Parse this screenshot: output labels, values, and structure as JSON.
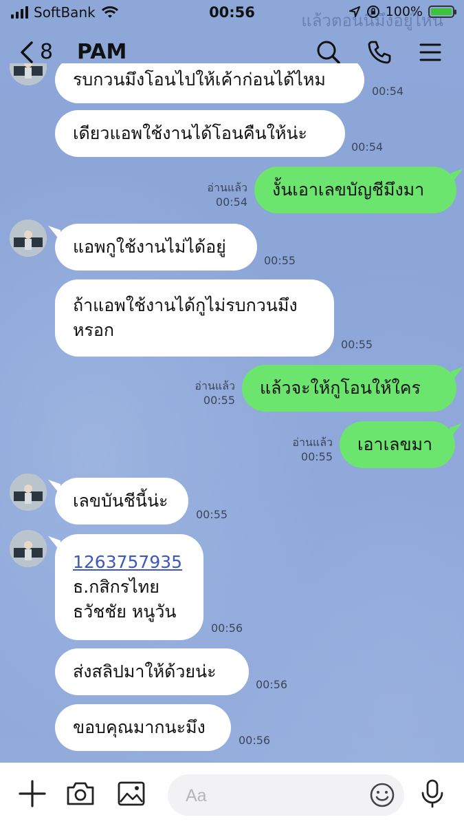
{
  "status_bar": {
    "carrier": "SoftBank",
    "time": "00:56",
    "battery": "100%",
    "battery_level": 1.0
  },
  "background_message": "แล้วตอนนี้มึงอยู่ไหน",
  "header": {
    "unread_count": "8",
    "contact_name": "PAM"
  },
  "messages": [
    {
      "side": "in",
      "lines": [
        "รบกวนมึงโอนไปให้เค้าก่อนได้ไหม"
      ],
      "time": "00:54"
    },
    {
      "side": "in",
      "lines": [
        "เดียวแอพใช้งานได้โอนคืนให้น่ะ"
      ],
      "time": "00:54"
    },
    {
      "side": "out",
      "lines": [
        "งั้นเอาเลขบัญชีมึงมา"
      ],
      "read": "อ่านแล้ว",
      "time": "00:54"
    },
    {
      "side": "in",
      "lines": [
        "แอพกูใช้งานไม่ได้อยู่"
      ],
      "time": "00:55"
    },
    {
      "side": "in",
      "lines": [
        "ถ้าแอพใช้งานได้กูไม่รบกวนมึง",
        "หรอก"
      ],
      "time": "00:55"
    },
    {
      "side": "out",
      "lines": [
        "แล้วจะให้กูโอนให้ใคร"
      ],
      "read": "อ่านแล้ว",
      "time": "00:55"
    },
    {
      "side": "out",
      "lines": [
        "เอาเลขมา"
      ],
      "read": "อ่านแล้ว",
      "time": "00:55"
    },
    {
      "side": "in",
      "lines": [
        "เลขบันชีนี้น่ะ"
      ],
      "time": "00:55"
    },
    {
      "side": "in",
      "link": "1263757935",
      "lines": [
        "ธ.กสิกรไทย",
        "ธวัชชัย หนูวัน"
      ],
      "time": "00:56"
    },
    {
      "side": "in",
      "lines": [
        "ส่งสลิปมาให้ด้วยน่ะ"
      ],
      "time": "00:56"
    },
    {
      "side": "in",
      "lines": [
        "ขอบคุณมากนะมึง"
      ],
      "time": "00:56"
    }
  ],
  "input": {
    "placeholder": "Aa"
  },
  "icons": [
    "back-chevron-icon",
    "search-icon",
    "phone-icon",
    "menu-icon",
    "plus-icon",
    "camera-icon",
    "image-icon",
    "emoji-icon",
    "microphone-icon"
  ]
}
